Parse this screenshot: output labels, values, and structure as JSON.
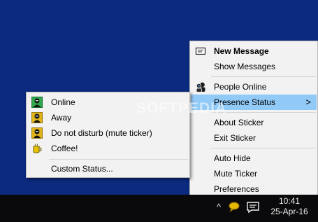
{
  "main_menu": {
    "items": [
      {
        "label": "New Message",
        "bold": true,
        "icon": "message-icon"
      },
      {
        "label": "Show Messages"
      },
      {
        "label": "People Online",
        "icon": "people-icon"
      },
      {
        "label": "Presence Status",
        "submenu": true
      },
      {
        "label": "About Sticker"
      },
      {
        "label": "Exit Sticker"
      },
      {
        "label": "Auto Hide"
      },
      {
        "label": "Mute Ticker"
      },
      {
        "label": "Preferences"
      }
    ],
    "arrow": ">"
  },
  "presence_menu": {
    "items": [
      {
        "label": "Online",
        "icon": "online-status-icon",
        "status_color": "#2fa84f"
      },
      {
        "label": "Away",
        "icon": "away-status-icon",
        "status_color": "#e0b21a"
      },
      {
        "label": "Do not disturb (mute ticker)",
        "icon": "dnd-status-icon",
        "status_color": "#e0b21a"
      },
      {
        "label": "Coffee!",
        "icon": "coffee-icon",
        "status_color": "#d8b400"
      },
      {
        "label": "Custom Status..."
      }
    ]
  },
  "taskbar": {
    "chevron": "^",
    "time": "10:41",
    "date": "25-Apr-16"
  },
  "watermark": "SOFTPEDIA",
  "colors": {
    "desktop": "#0c2a7e",
    "menu_bg": "#f2f2f2",
    "highlight": "#91c9f7",
    "taskbar": "#0a0a0c"
  }
}
